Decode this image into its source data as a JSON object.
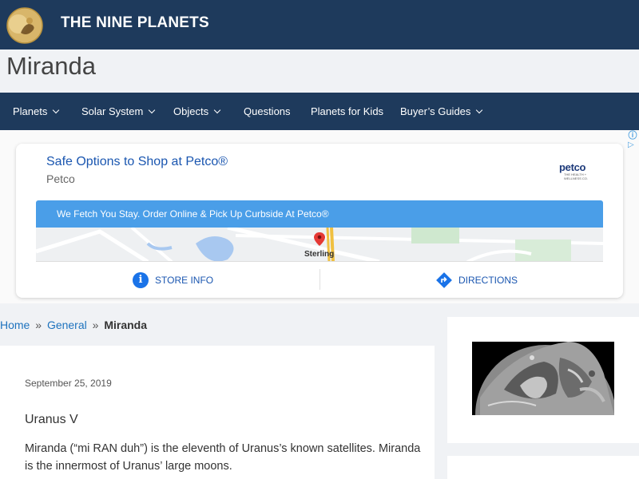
{
  "header": {
    "site_title": "THE NINE PLANETS",
    "logo_icon": "moon-logo-icon"
  },
  "page": {
    "title": "Miranda"
  },
  "nav": {
    "items": [
      {
        "label": "Planets",
        "has_dropdown": true
      },
      {
        "label": "Solar System",
        "has_dropdown": true
      },
      {
        "label": "Objects",
        "has_dropdown": true
      },
      {
        "label": "Questions",
        "has_dropdown": false
      },
      {
        "label": "Planets for Kids",
        "has_dropdown": false
      },
      {
        "label": "Buyer’s Guides",
        "has_dropdown": true
      }
    ]
  },
  "ad": {
    "headline": "Safe Options to Shop at Petco®",
    "advertiser": "Petco",
    "brand_logo_text": "petco",
    "brand_logo_tagline": "THE HEALTH + WELLNESS CO.",
    "banner_text": "We Fetch You Stay. Order Online & Pick Up Curbside At Petco®",
    "map_label": "Sterling",
    "store_info_label": "STORE INFO",
    "directions_label": "DIRECTIONS",
    "colors": {
      "banner": "#4a9ee8",
      "link": "#1a56b0"
    }
  },
  "breadcrumb": {
    "home": "Home",
    "separator": "»",
    "category": "General",
    "current": "Miranda"
  },
  "article": {
    "date": "September 25, 2019",
    "subtitle": "Uranus V",
    "body": "Miranda (“mi RAN duh”) is the eleventh of Uranus’s known satellites. Miranda is the innermost of Uranus’ large moons."
  },
  "colors": {
    "header_bg": "#1e3a5c",
    "page_bg": "#f0f2f5",
    "link": "#1e73be"
  }
}
